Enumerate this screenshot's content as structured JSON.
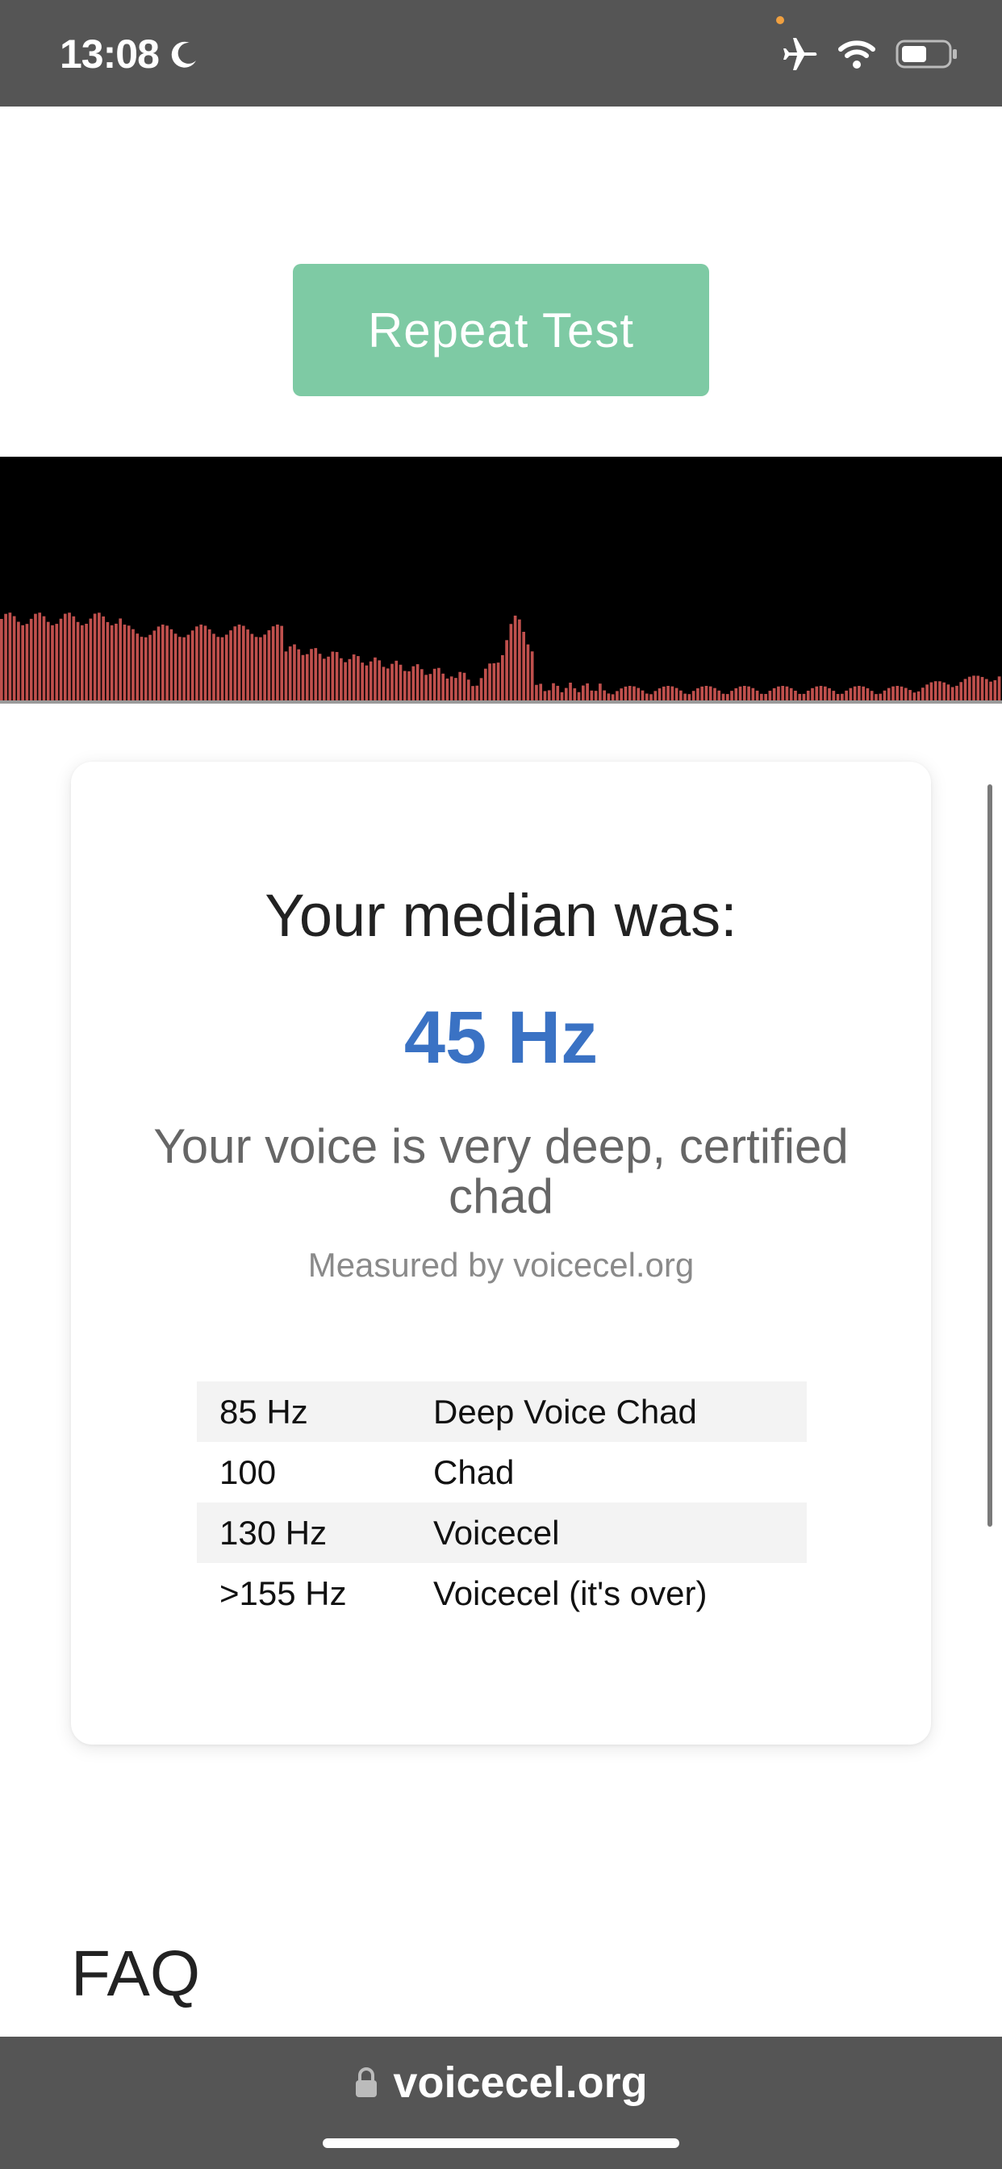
{
  "status_bar": {
    "time": "13:08",
    "icons": [
      "moon-icon",
      "airplane-icon",
      "wifi-icon",
      "battery-icon"
    ],
    "background": "#555555"
  },
  "repeat_button": {
    "label": "Repeat Test",
    "color": "#7ecaa4"
  },
  "visualizer": {
    "bar_color": "#c0504d",
    "background": "#000000"
  },
  "result": {
    "median_label": "Your median was:",
    "median_value": "45 Hz",
    "verdict": "Your voice is very deep, certified chad",
    "measured_by": "Measured by voicecel.org",
    "accent": "#3a72c4"
  },
  "ranges": [
    {
      "freq": "85 Hz",
      "label": "Deep Voice Chad"
    },
    {
      "freq": "100",
      "label": "Chad"
    },
    {
      "freq": "130 Hz",
      "label": "Voicecel"
    },
    {
      "freq": ">155 Hz",
      "label": "Voicecel (it's over)"
    }
  ],
  "faq": {
    "heading": "FAQ"
  },
  "url_bar": {
    "url": "voicecel.org"
  }
}
